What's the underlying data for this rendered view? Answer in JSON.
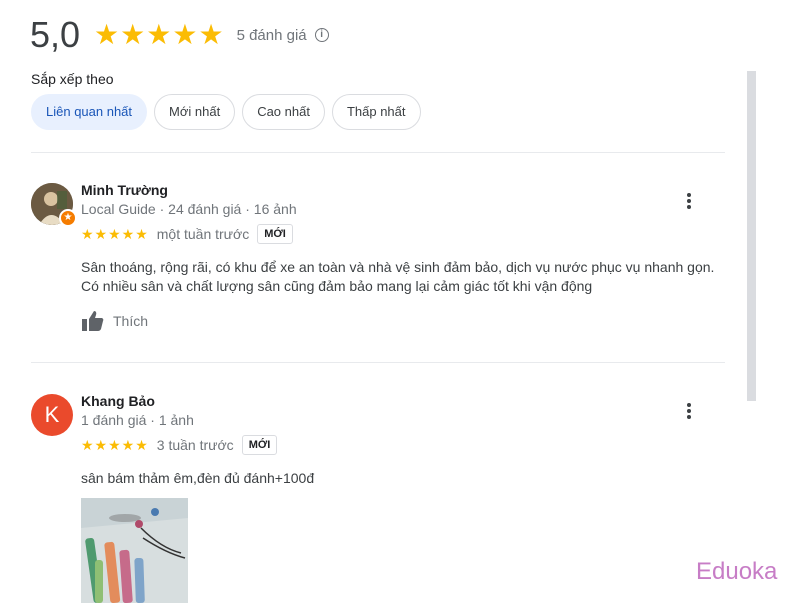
{
  "summary": {
    "rating": "5,0",
    "stars": "★★★★★",
    "count_text": "5 đánh giá",
    "info_icon": "info-icon"
  },
  "sort": {
    "label": "Sắp xếp theo",
    "options": [
      "Liên quan nhất",
      "Mới nhất",
      "Cao nhất",
      "Thấp nhất"
    ],
    "selected": "Liên quan nhất"
  },
  "reviews": [
    {
      "name": "Minh Trường",
      "meta": "Local Guide · 24 đánh giá · 16 ảnh",
      "stars": "★★★★★",
      "time": "một tuần trước",
      "badge": "MỚI",
      "text": "Sân thoáng, rộng rãi, có khu để xe an toàn và nhà vệ sinh đảm bảo, dịch vụ nước phục vụ nhanh gọn. Có nhiều sân và chất lượng sân cũng đảm bảo mang lại cảm giác tốt khi vận động",
      "like_label": "Thích",
      "avatar_icon": "user-photo-icon",
      "guide_badge_icon": "local-guide-star-icon"
    },
    {
      "name": "Khang Bảo",
      "meta": "1 đánh giá · 1 ảnh",
      "avatar_letter": "K",
      "stars": "★★★★★",
      "time": "3 tuần trước",
      "badge": "MỚI",
      "text": "sân bám thảm êm,đèn đủ đánh+100đ"
    }
  ],
  "colors": {
    "star": "#fbbc04",
    "chip_selected_bg": "#e8f0fe",
    "chip_selected_text": "#1a56b8",
    "avatar_k": "#ea4a2c",
    "watermark": "#c77dc6"
  },
  "watermark": "Eduoka"
}
